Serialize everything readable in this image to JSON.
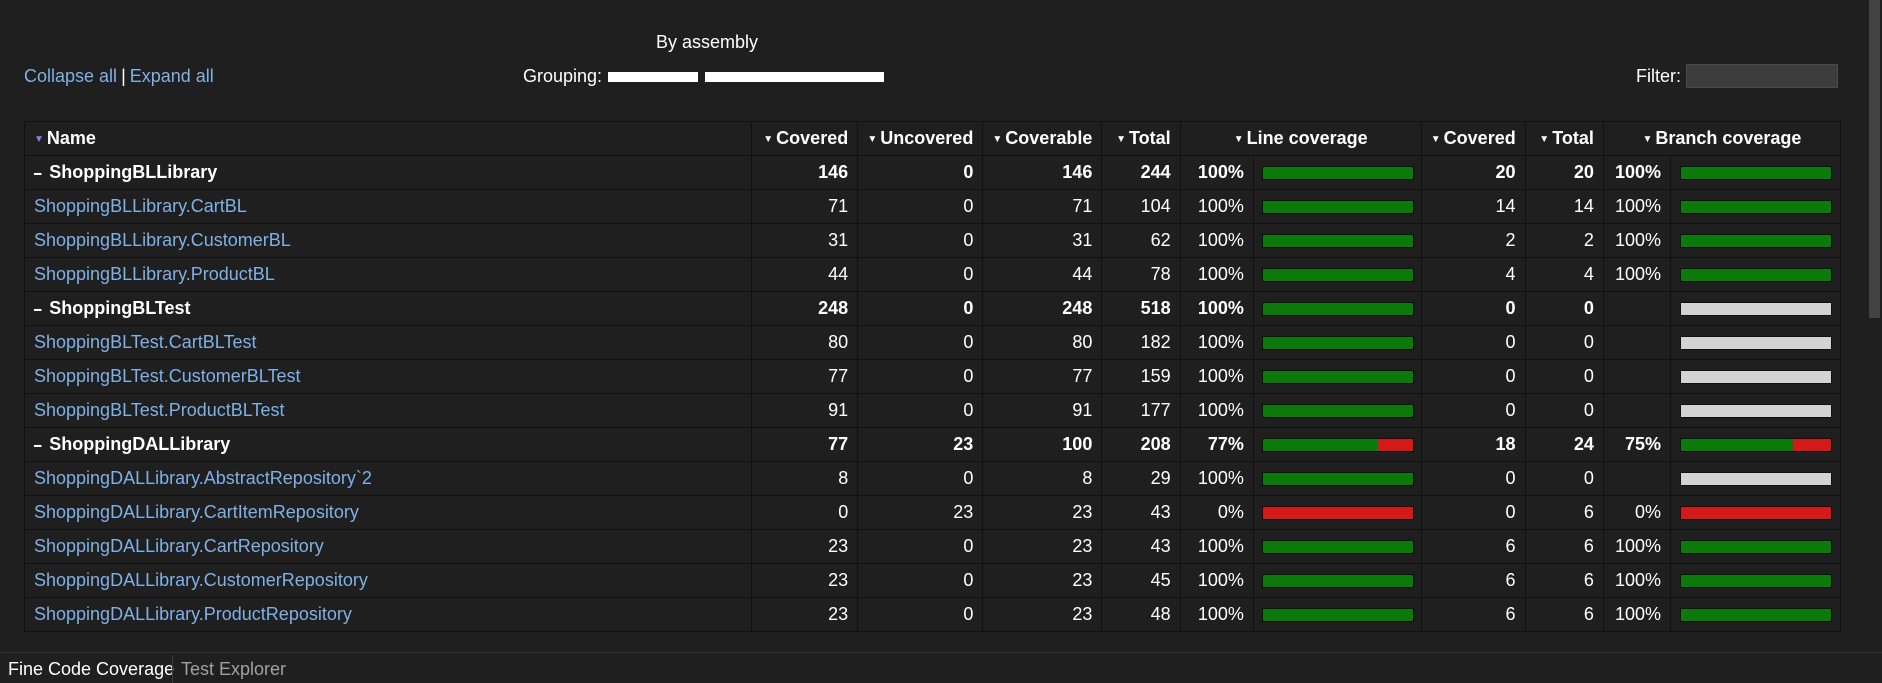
{
  "header": {
    "grouping_title": "By assembly",
    "collapse_all": "Collapse all",
    "separator": "|",
    "expand_all": "Expand all",
    "grouping_label": "Grouping:",
    "filter_label": "Filter:",
    "filter_value": ""
  },
  "columns": {
    "name": "Name",
    "covered": "Covered",
    "uncovered": "Uncovered",
    "coverable": "Coverable",
    "total": "Total",
    "line_coverage": "Line coverage",
    "branch_covered": "Covered",
    "branch_total": "Total",
    "branch_coverage": "Branch coverage"
  },
  "rows": [
    {
      "group": true,
      "name": "ShoppingBLLibrary",
      "covered": "146",
      "uncovered": "0",
      "coverable": "146",
      "total": "244",
      "line_pct": "100%",
      "line_fill": 1.0,
      "b_covered": "20",
      "b_total": "20",
      "branch_pct": "100%",
      "branch_fill": 1.0
    },
    {
      "group": false,
      "name": "ShoppingBLLibrary.CartBL",
      "covered": "71",
      "uncovered": "0",
      "coverable": "71",
      "total": "104",
      "line_pct": "100%",
      "line_fill": 1.0,
      "b_covered": "14",
      "b_total": "14",
      "branch_pct": "100%",
      "branch_fill": 1.0
    },
    {
      "group": false,
      "name": "ShoppingBLLibrary.CustomerBL",
      "covered": "31",
      "uncovered": "0",
      "coverable": "31",
      "total": "62",
      "line_pct": "100%",
      "line_fill": 1.0,
      "b_covered": "2",
      "b_total": "2",
      "branch_pct": "100%",
      "branch_fill": 1.0
    },
    {
      "group": false,
      "name": "ShoppingBLLibrary.ProductBL",
      "covered": "44",
      "uncovered": "0",
      "coverable": "44",
      "total": "78",
      "line_pct": "100%",
      "line_fill": 1.0,
      "b_covered": "4",
      "b_total": "4",
      "branch_pct": "100%",
      "branch_fill": 1.0
    },
    {
      "group": true,
      "name": "ShoppingBLTest",
      "covered": "248",
      "uncovered": "0",
      "coverable": "248",
      "total": "518",
      "line_pct": "100%",
      "line_fill": 1.0,
      "b_covered": "0",
      "b_total": "0",
      "branch_pct": "",
      "branch_fill": null
    },
    {
      "group": false,
      "name": "ShoppingBLTest.CartBLTest",
      "covered": "80",
      "uncovered": "0",
      "coverable": "80",
      "total": "182",
      "line_pct": "100%",
      "line_fill": 1.0,
      "b_covered": "0",
      "b_total": "0",
      "branch_pct": "",
      "branch_fill": null
    },
    {
      "group": false,
      "name": "ShoppingBLTest.CustomerBLTest",
      "covered": "77",
      "uncovered": "0",
      "coverable": "77",
      "total": "159",
      "line_pct": "100%",
      "line_fill": 1.0,
      "b_covered": "0",
      "b_total": "0",
      "branch_pct": "",
      "branch_fill": null
    },
    {
      "group": false,
      "name": "ShoppingBLTest.ProductBLTest",
      "covered": "91",
      "uncovered": "0",
      "coverable": "91",
      "total": "177",
      "line_pct": "100%",
      "line_fill": 1.0,
      "b_covered": "0",
      "b_total": "0",
      "branch_pct": "",
      "branch_fill": null
    },
    {
      "group": true,
      "name": "ShoppingDALLibrary",
      "covered": "77",
      "uncovered": "23",
      "coverable": "100",
      "total": "208",
      "line_pct": "77%",
      "line_fill": 0.77,
      "b_covered": "18",
      "b_total": "24",
      "branch_pct": "75%",
      "branch_fill": 0.75
    },
    {
      "group": false,
      "name": "ShoppingDALLibrary.AbstractRepository`2",
      "covered": "8",
      "uncovered": "0",
      "coverable": "8",
      "total": "29",
      "line_pct": "100%",
      "line_fill": 1.0,
      "b_covered": "0",
      "b_total": "0",
      "branch_pct": "",
      "branch_fill": null
    },
    {
      "group": false,
      "name": "ShoppingDALLibrary.CartItemRepository",
      "covered": "0",
      "uncovered": "23",
      "coverable": "23",
      "total": "43",
      "line_pct": "0%",
      "line_fill": 0.0,
      "b_covered": "0",
      "b_total": "6",
      "branch_pct": "0%",
      "branch_fill": 0.0
    },
    {
      "group": false,
      "name": "ShoppingDALLibrary.CartRepository",
      "covered": "23",
      "uncovered": "0",
      "coverable": "23",
      "total": "43",
      "line_pct": "100%",
      "line_fill": 1.0,
      "b_covered": "6",
      "b_total": "6",
      "branch_pct": "100%",
      "branch_fill": 1.0
    },
    {
      "group": false,
      "name": "ShoppingDALLibrary.CustomerRepository",
      "covered": "23",
      "uncovered": "0",
      "coverable": "23",
      "total": "45",
      "line_pct": "100%",
      "line_fill": 1.0,
      "b_covered": "6",
      "b_total": "6",
      "branch_pct": "100%",
      "branch_fill": 1.0
    },
    {
      "group": false,
      "name": "ShoppingDALLibrary.ProductRepository",
      "covered": "23",
      "uncovered": "0",
      "coverable": "23",
      "total": "48",
      "line_pct": "100%",
      "line_fill": 1.0,
      "b_covered": "6",
      "b_total": "6",
      "branch_pct": "100%",
      "branch_fill": 1.0
    }
  ],
  "icons": {
    "sort": "sort-down-icon",
    "collapse_group": "minus-icon"
  },
  "colors": {
    "covered": "#0b7a0b",
    "uncovered": "#d41919",
    "no_data": "#d3d3d3",
    "link": "#7fb0e6",
    "active_sort": "#9a78e6"
  },
  "tabs": [
    {
      "label": "Fine Code Coverage",
      "active": true
    },
    {
      "label": "Test Explorer",
      "active": false
    }
  ]
}
